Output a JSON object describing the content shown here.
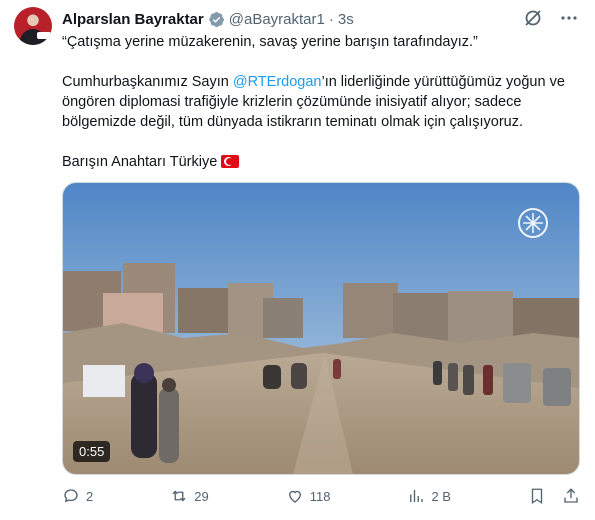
{
  "author": {
    "name": "Alparslan Bayraktar",
    "handle": "@aBayraktar1",
    "separator": "·",
    "time": "3s"
  },
  "tweet": {
    "quote": "“Çatışma yerine müzakerenin, savaş yerine barışın tarafındayız.”",
    "body_prefix": "Cumhurbaşkanımız Sayın ",
    "mention": "@RTErdogan",
    "body_suffix": "’ın liderliğinde yürüttüğümüz yoğun ve öngören diplomasi trafiğiyle krizlerin çözümünde inisiyatif alıyor; sadece bölgemizde değil, tüm dünyada istikrarın teminatı olmak için çalışıyoruz.",
    "closing": "Barışın Anahtarı Türkiye"
  },
  "media": {
    "duration": "0:55"
  },
  "actions": {
    "replies": "2",
    "reposts": "29",
    "likes": "118",
    "views": "2 B"
  },
  "colors": {
    "accent": "#1d9bf0",
    "muted": "#536471",
    "repost_green": "#00ba7c"
  },
  "icons": [
    "verified-badge-icon",
    "grok-icon",
    "more-icon",
    "reply-icon",
    "repost-icon",
    "like-icon",
    "views-icon",
    "bookmark-icon",
    "share-icon"
  ]
}
